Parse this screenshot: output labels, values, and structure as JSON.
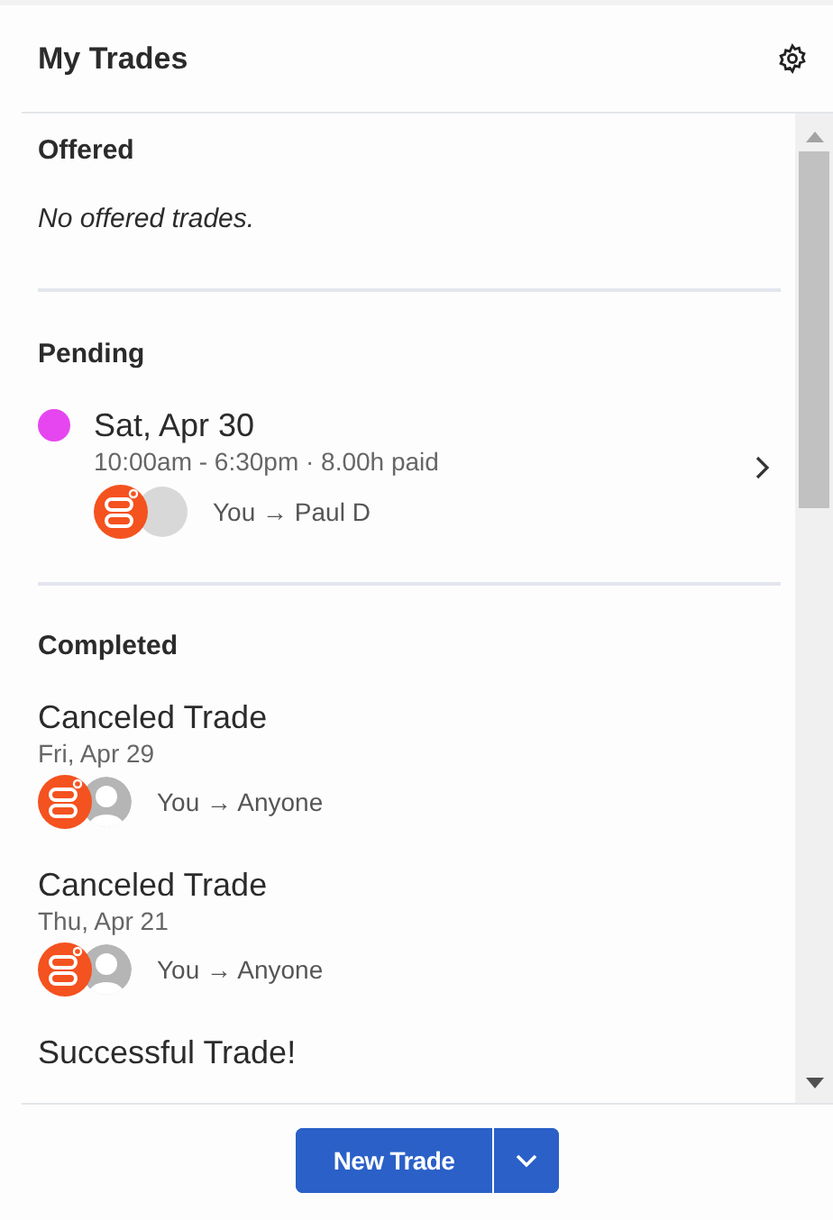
{
  "title": "My Trades",
  "offered": {
    "heading": "Offered",
    "empty_text": "No offered trades."
  },
  "pending": {
    "heading": "Pending",
    "trades": [
      {
        "date": "Sat, Apr 30",
        "details": "10:00am - 6:30pm · 8.00h paid",
        "parties": "You → Paul D",
        "color": "#e646f0",
        "avatar": {
          "kind": "photo"
        }
      }
    ]
  },
  "completed": {
    "heading": "Completed",
    "trades": [
      {
        "title": "Canceled Trade",
        "date": "Fri, Apr 29",
        "parties": "You → Anyone",
        "avatar": {
          "kind": "placeholder"
        }
      },
      {
        "title": "Canceled Trade",
        "date": "Thu, Apr 21",
        "parties": "You → Anyone",
        "avatar": {
          "kind": "placeholder"
        }
      },
      {
        "title": "Successful Trade!"
      }
    ]
  },
  "button": {
    "label": "New Trade"
  }
}
